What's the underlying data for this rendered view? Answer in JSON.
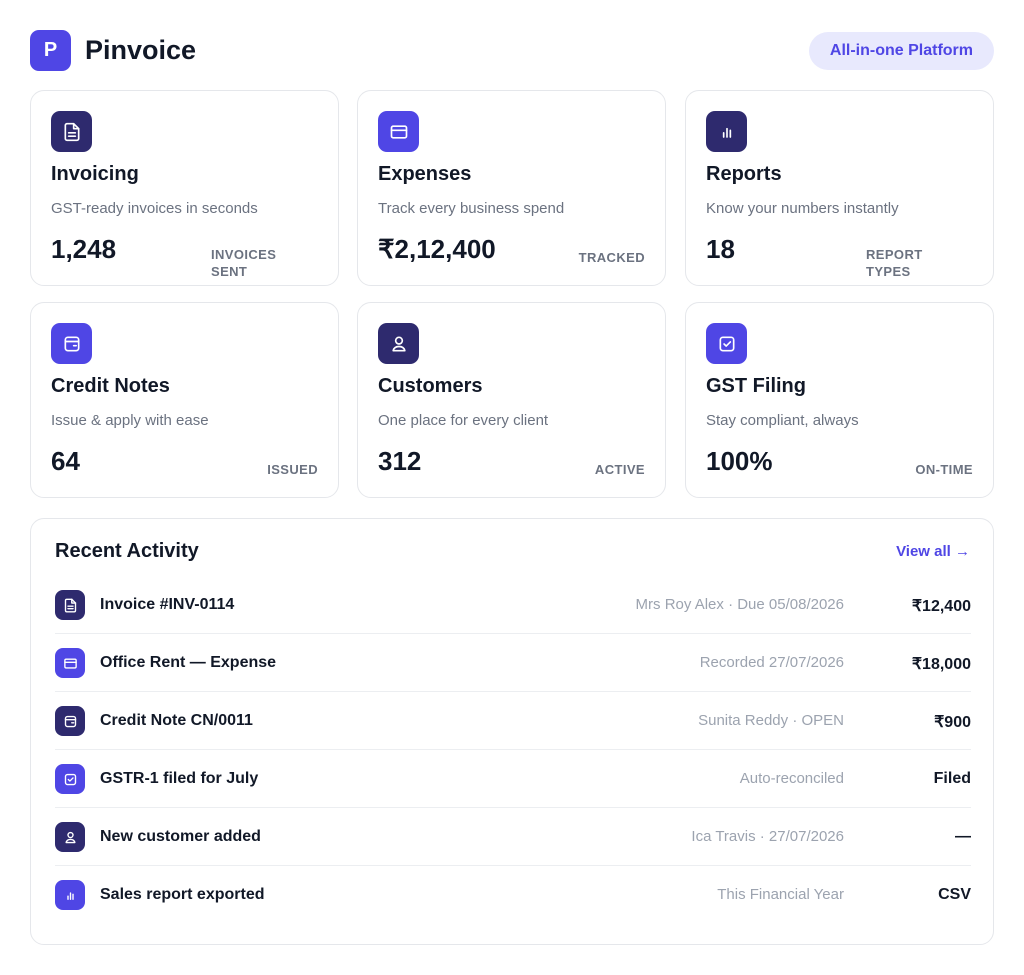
{
  "app": {
    "logo_letter": "P",
    "name": "Pinvoice",
    "badge": "All-in-one Platform"
  },
  "colors": {
    "accent": "#4f46e5",
    "dark_icon": "#2e2a6e",
    "pill_bg": "#e8e9fd"
  },
  "cards": [
    {
      "icon": "document-icon",
      "title": "Invoicing",
      "subtitle": "GST-ready invoices in seconds",
      "value": "1,248",
      "label_line1": "INVOICES",
      "label_line2": "SENT"
    },
    {
      "icon": "card-icon",
      "title": "Expenses",
      "subtitle": "Track every business spend",
      "value": "₹2,12,400",
      "label": "TRACKED"
    },
    {
      "icon": "bar-chart-icon",
      "title": "Reports",
      "subtitle": "Know your numbers instantly",
      "value": "18",
      "label_line1": "REPORT",
      "label_line2": "TYPES"
    },
    {
      "icon": "wallet-icon",
      "title": "Credit Notes",
      "subtitle": "Issue & apply with ease",
      "value": "64",
      "label": "ISSUED"
    },
    {
      "icon": "user-icon",
      "title": "Customers",
      "subtitle": "One place for every client",
      "value": "312",
      "label": "ACTIVE"
    },
    {
      "icon": "checkbox-icon",
      "title": "GST Filing",
      "subtitle": "Stay compliant, always",
      "value": "100%",
      "label": "ON-TIME"
    }
  ],
  "activity": {
    "title": "Recent Activity",
    "view_all": "View all →",
    "rows": [
      {
        "icon": "document-icon",
        "title": "Invoice #INV-0114",
        "meta": "Mrs Roy Alex · Due 05/08/2026",
        "value": "₹12,400"
      },
      {
        "icon": "card-icon",
        "title": "Office Rent — Expense",
        "meta": "Recorded 27/07/2026",
        "value": "₹18,000"
      },
      {
        "icon": "wallet-icon",
        "title": "Credit Note CN/0011",
        "meta": "Sunita Reddy · OPEN",
        "value": "₹900"
      },
      {
        "icon": "checkbox-icon",
        "title": "GSTR-1 filed for July",
        "meta": "Auto-reconciled",
        "value": "Filed"
      },
      {
        "icon": "user-icon",
        "title": "New customer added",
        "meta": "Ica Travis · 27/07/2026",
        "value": "—"
      },
      {
        "icon": "bar-chart-icon",
        "title": "Sales report exported",
        "meta": "This Financial Year",
        "value": "CSV"
      }
    ]
  }
}
